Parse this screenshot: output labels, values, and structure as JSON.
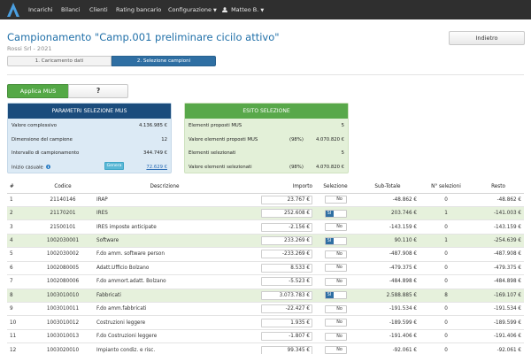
{
  "navbar": {
    "items": [
      "Incarichi",
      "Bilanci",
      "Clienti",
      "Rating bancario"
    ],
    "config_label": "Configurazione",
    "user_label": "Matteo B."
  },
  "header": {
    "title": "Campionamento \"Camp.001 preliminare cicilo attivo\"",
    "subtitle": "Rossi Srl - 2021",
    "back_label": "Indietro"
  },
  "steps": [
    "1. Caricamento dati",
    "2. Selezione campioni"
  ],
  "actions": {
    "applica_label": "Applica MUS",
    "help_label": "?"
  },
  "params_panel": {
    "title": "PARAMETRI SELEZIONE MUS",
    "rows": [
      {
        "label": "Valore complessivo",
        "value": "4.136.985 €"
      },
      {
        "label": "Dimensione del campione",
        "value": "12"
      },
      {
        "label": "Intervallo di campionamento",
        "value": "344.749 €"
      },
      {
        "label": "Inizio casuale",
        "value": "72.629 €",
        "button": "Genera"
      }
    ]
  },
  "result_panel": {
    "title": "ESITO SELEZIONE",
    "rows": [
      {
        "label": "Elementi proposti MUS",
        "pct": "",
        "value": "5"
      },
      {
        "label": "Valore elementi proposti MUS",
        "pct": "(98%)",
        "value": "4.070.820 €"
      },
      {
        "label": "Elementi selezionati",
        "pct": "",
        "value": "5"
      },
      {
        "label": "Valore elementi selezionati",
        "pct": "(98%)",
        "value": "4.070.820 €"
      }
    ]
  },
  "table": {
    "headers": [
      "#",
      "Codice",
      "Descrizione",
      "Importo",
      "Selezione",
      "Sub-Totale",
      "N° selezioni",
      "Resto"
    ],
    "toggle_si": "SI",
    "toggle_no": "No",
    "rows": [
      {
        "n": "1",
        "code": "21140146",
        "desc": "IRAP",
        "imp": "23.767 €",
        "si": false,
        "sub": "-48.862 €",
        "nsel": "0",
        "resto": "-48.862 €"
      },
      {
        "n": "2",
        "code": "21170201",
        "desc": "IRES",
        "imp": "252.608 €",
        "si": true,
        "sub": "203.746 €",
        "nsel": "1",
        "resto": "-141.003 €"
      },
      {
        "n": "3",
        "code": "21500101",
        "desc": "IRES imposte anticipate",
        "imp": "-2.156 €",
        "si": false,
        "sub": "-143.159 €",
        "nsel": "0",
        "resto": "-143.159 €"
      },
      {
        "n": "4",
        "code": "1002030001",
        "desc": "Software",
        "imp": "233.269 €",
        "si": true,
        "sub": "90.110 €",
        "nsel": "1",
        "resto": "-254.639 €"
      },
      {
        "n": "5",
        "code": "1002030002",
        "desc": "F.do amm. software person",
        "imp": "-233.269 €",
        "si": false,
        "sub": "-487.908 €",
        "nsel": "0",
        "resto": "-487.908 €"
      },
      {
        "n": "6",
        "code": "1002080005",
        "desc": "Adatt.Ufficio Bolzano",
        "imp": "8.533 €",
        "si": false,
        "sub": "-479.375 €",
        "nsel": "0",
        "resto": "-479.375 €"
      },
      {
        "n": "7",
        "code": "1002080006",
        "desc": "F.do ammort.adatt. Bolzano",
        "imp": "-5.523 €",
        "si": false,
        "sub": "-484.898 €",
        "nsel": "0",
        "resto": "-484.898 €"
      },
      {
        "n": "8",
        "code": "1003010010",
        "desc": "Fabbricati",
        "imp": "3.073.783 €",
        "si": true,
        "sub": "2.588.885 €",
        "nsel": "8",
        "resto": "-169.107 €"
      },
      {
        "n": "9",
        "code": "1003010011",
        "desc": "F.do amm.fabbricati",
        "imp": "-22.427 €",
        "si": false,
        "sub": "-191.534 €",
        "nsel": "0",
        "resto": "-191.534 €"
      },
      {
        "n": "10",
        "code": "1003010012",
        "desc": "Costruzioni leggere",
        "imp": "1.935 €",
        "si": false,
        "sub": "-189.599 €",
        "nsel": "0",
        "resto": "-189.599 €"
      },
      {
        "n": "11",
        "code": "1003010013",
        "desc": "F.do Costruzioni leggere",
        "imp": "-1.807 €",
        "si": false,
        "sub": "-191.406 €",
        "nsel": "0",
        "resto": "-191.406 €"
      },
      {
        "n": "12",
        "code": "1003020010",
        "desc": "Impianto condiz. e risc.",
        "imp": "99.345 €",
        "si": false,
        "sub": "-92.061 €",
        "nsel": "0",
        "resto": "-92.061 €"
      }
    ]
  }
}
